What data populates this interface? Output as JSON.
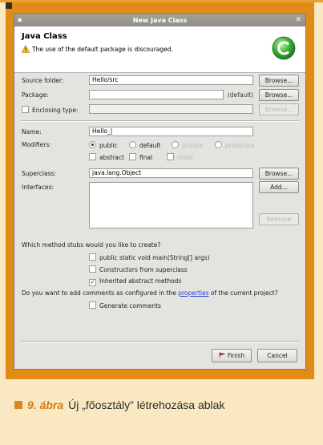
{
  "window": {
    "title": "New Java Class",
    "menu_glyph": "▪",
    "close_glyph": "✕"
  },
  "banner": {
    "heading": "Java Class",
    "message": "The use of the default package is discouraged.",
    "logo_icon": "new-class-wizard-icon",
    "warning_icon": "warning-triangle-icon"
  },
  "form": {
    "source_folder": {
      "label": "Source folder:",
      "value": "Hello/src",
      "button": "Browse..."
    },
    "package": {
      "label": "Package:",
      "value": "",
      "suffix": "(default)",
      "button": "Browse..."
    },
    "enclosing_type": {
      "label": "Enclosing type:",
      "value": "",
      "button": "Browse...",
      "checked": false
    },
    "name": {
      "label": "Name:",
      "value": "Hello_|"
    },
    "modifiers": {
      "label": "Modifiers:",
      "access": [
        {
          "label": "public",
          "selected": true,
          "enabled": true
        },
        {
          "label": "default",
          "selected": false,
          "enabled": true
        },
        {
          "label": "private",
          "selected": false,
          "enabled": false
        },
        {
          "label": "protected",
          "selected": false,
          "enabled": false
        }
      ],
      "flags": [
        {
          "label": "abstract",
          "checked": false,
          "enabled": true
        },
        {
          "label": "final",
          "checked": false,
          "enabled": true
        },
        {
          "label": "static",
          "checked": false,
          "enabled": false
        }
      ]
    },
    "superclass": {
      "label": "Superclass:",
      "value": "java.lang.Object",
      "button": "Browse..."
    },
    "interfaces": {
      "label": "Interfaces:",
      "add_button": "Add...",
      "remove_button": "Remove"
    }
  },
  "stubs": {
    "question": "Which method stubs would you like to create?",
    "items": [
      {
        "label": "public static void main(String[] args)",
        "checked": false
      },
      {
        "label": "Constructors from superclass",
        "checked": false
      },
      {
        "label": "Inherited abstract methods",
        "checked": true
      }
    ]
  },
  "comments": {
    "question_before": "Do you want to add comments as configured in the ",
    "question_link": "properties",
    "question_after": " of the current project?",
    "generate_label": "Generate comments",
    "checked": false
  },
  "footer": {
    "finish": "Finish",
    "cancel": "Cancel"
  },
  "caption": {
    "figure": "9. ábra",
    "text": "Új „főosztály” létrehozása ablak"
  },
  "colors": {
    "frame": "#e38b17",
    "accent": "#d87a13",
    "background": "#f9e8c2"
  }
}
